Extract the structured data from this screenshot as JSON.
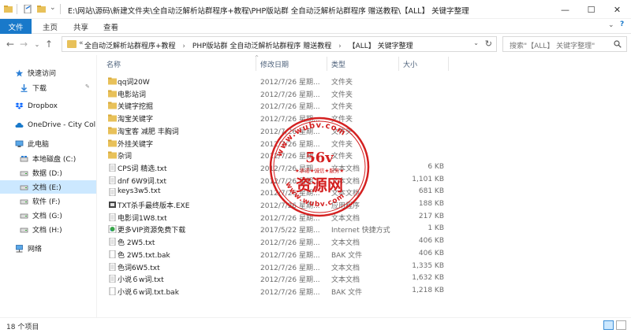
{
  "window": {
    "title": "E:\\网站\\源码\\新建文件夹\\全自动泛解析站群程序+教程\\PHP版站群 全自动泛解析站群程序 赠送教程\\【ALL】 关键字整理",
    "minimize": "—",
    "maximize": "☐",
    "close": "✕"
  },
  "ribbon": {
    "tabs": [
      "文件",
      "主页",
      "共享",
      "查看"
    ],
    "collapse_glyph": "⌄",
    "help_glyph": "?"
  },
  "nav_buttons": {
    "back": "←",
    "forward": "→",
    "recent": "⌄",
    "up": "↑"
  },
  "address": {
    "prefix": "«",
    "path": [
      "全自动泛解析站群程序+教程",
      "PHP版站群 全自动泛解析站群程序 赠送教程",
      "【ALL】 关键字整理"
    ],
    "separator": "›",
    "dropdown": "⌄",
    "refresh": "↻"
  },
  "search": {
    "placeholder": "搜索\"【ALL】 关键字整理\""
  },
  "sidebar": {
    "items": [
      {
        "label": "快速访问",
        "icon": "star-icon"
      },
      {
        "label": "下载",
        "icon": "download-icon",
        "pinned": "📌"
      },
      {
        "label": "Dropbox",
        "icon": "dropbox-icon"
      },
      {
        "label": "OneDrive - City Col",
        "icon": "cloud-icon"
      },
      {
        "label": "此电脑",
        "icon": "computer-icon"
      },
      {
        "label": "本地磁盘 (C:)",
        "icon": "drive-icon"
      },
      {
        "label": "数据 (D:)",
        "icon": "drive-icon"
      },
      {
        "label": "文档 (E:)",
        "icon": "drive-icon",
        "selected": true
      },
      {
        "label": "软件 (F:)",
        "icon": "drive-icon"
      },
      {
        "label": "文档 (G:)",
        "icon": "drive-icon"
      },
      {
        "label": "文档 (H:)",
        "icon": "drive-icon"
      },
      {
        "label": "网络",
        "icon": "network-icon"
      }
    ]
  },
  "columns": {
    "name": "名称",
    "date": "修改日期",
    "type": "类型",
    "size": "大小"
  },
  "files": [
    {
      "name": "qq词20W",
      "date": "2012/7/26 星期...",
      "type": "文件夹",
      "size": "",
      "icon": "folder"
    },
    {
      "name": "电影站词",
      "date": "2012/7/26 星期...",
      "type": "文件夹",
      "size": "",
      "icon": "folder"
    },
    {
      "name": "关键字挖掘",
      "date": "2012/7/26 星期...",
      "type": "文件夹",
      "size": "",
      "icon": "folder"
    },
    {
      "name": "淘宝关键字",
      "date": "2012/7/26 星期...",
      "type": "文件夹",
      "size": "",
      "icon": "folder"
    },
    {
      "name": "淘宝客 减肥 丰胸词",
      "date": "2012/7/26 星期...",
      "type": "文件夹",
      "size": "",
      "icon": "folder"
    },
    {
      "name": "外挂关键字",
      "date": "2012/7/26 星期...",
      "type": "文件夹",
      "size": "",
      "icon": "folder"
    },
    {
      "name": "杂词",
      "date": "2012/7/26 星期...",
      "type": "文件夹",
      "size": "",
      "icon": "folder"
    },
    {
      "name": "CPS词 精选.txt",
      "date": "2012/7/26 星期...",
      "type": "文本文档",
      "size": "6 KB",
      "icon": "txt"
    },
    {
      "name": "dnf 6W9词.txt",
      "date": "2012/7/26 星期...",
      "type": "文本文档",
      "size": "1,101 KB",
      "icon": "txt"
    },
    {
      "name": "keys3w5.txt",
      "date": "2012/7/26 星期...",
      "type": "文本文档",
      "size": "681 KB",
      "icon": "txt"
    },
    {
      "name": "TXT杀手最终版本.EXE",
      "date": "2012/7/26 星期...",
      "type": "应用程序",
      "size": "188 KB",
      "icon": "exe"
    },
    {
      "name": "电影词1W8.txt",
      "date": "2012/7/26 星期...",
      "type": "文本文档",
      "size": "217 KB",
      "icon": "txt"
    },
    {
      "name": "更多VIP资源免费下载",
      "date": "2017/5/22 星期...",
      "type": "Internet 快捷方式",
      "size": "1 KB",
      "icon": "url"
    },
    {
      "name": "色 2W5.txt",
      "date": "2012/7/26 星期...",
      "type": "文本文档",
      "size": "406 KB",
      "icon": "txt"
    },
    {
      "name": "色 2W5.txt.bak",
      "date": "2012/7/26 星期...",
      "type": "BAK 文件",
      "size": "406 KB",
      "icon": "bak"
    },
    {
      "name": "色词6W5.txt",
      "date": "2012/7/26 星期...",
      "type": "文本文档",
      "size": "1,335 KB",
      "icon": "txt"
    },
    {
      "name": "小说６w词.txt",
      "date": "2012/7/26 星期...",
      "type": "文本文档",
      "size": "1,632 KB",
      "icon": "txt"
    },
    {
      "name": "小说６w词.txt.bak",
      "date": "2012/7/26 星期...",
      "type": "BAK 文件",
      "size": "1,218 KB",
      "icon": "bak"
    }
  ],
  "status": {
    "count": "18 个项目"
  },
  "watermark": {
    "top_text": "www.wubv.com",
    "bottom_text": "www.wubv.com",
    "brand": "56v",
    "slogan": "★承诺★诚信★服务★",
    "name": "资源网",
    "color": "#d42020"
  },
  "colors": {
    "accent": "#1979ca",
    "selection": "#cce8ff",
    "folder": "#e8c15a"
  }
}
